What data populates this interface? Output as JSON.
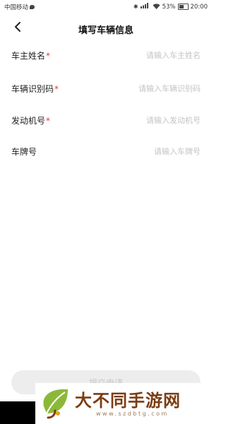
{
  "status_bar": {
    "carrier": "中国移动",
    "battery": "53%",
    "time": "20:00"
  },
  "nav": {
    "title": "填写车辆信息",
    "back_icon": "chevron-left-icon"
  },
  "form": {
    "fields": [
      {
        "label": "车主姓名",
        "required": "*",
        "placeholder": "请输入车主姓名"
      },
      {
        "label": "车辆识别码",
        "required": "*",
        "placeholder": "请输入车辆识别码"
      },
      {
        "label": "发动机号",
        "required": "*",
        "placeholder": "请输入发动机号"
      },
      {
        "label": "车牌号",
        "required": "",
        "placeholder": "请输入车牌号"
      }
    ]
  },
  "submit": {
    "label": "提交申请"
  },
  "watermark": {
    "title": "大不同手游网",
    "url": "www.szdbtg.com"
  },
  "colors": {
    "required": "#e23b3b",
    "watermark": "#7a3d12",
    "placeholder": "#c4c4c4"
  }
}
